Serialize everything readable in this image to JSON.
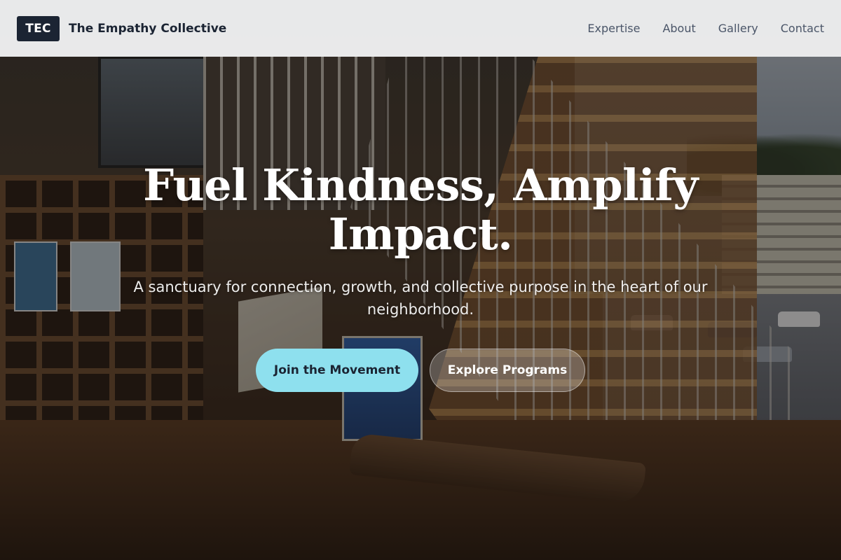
{
  "navbar": {
    "logo_text": "TEC",
    "brand_name": "The Empathy Collective",
    "links": [
      {
        "label": "Expertise"
      },
      {
        "label": "About"
      },
      {
        "label": "Gallery"
      },
      {
        "label": "Contact"
      }
    ]
  },
  "hero": {
    "headline": "Fuel Kindness, Amplify Impact.",
    "subheadline": "A sanctuary for connection, growth, and collective purpose in the heart of our neighborhood.",
    "primary_cta": "Join the Movement",
    "secondary_cta": "Explore Programs"
  },
  "colors": {
    "brand_dark": "#1b2433",
    "accent": "#8ee0ee",
    "nav_text": "#4a5568"
  },
  "icons": [
    "logo-mark"
  ]
}
